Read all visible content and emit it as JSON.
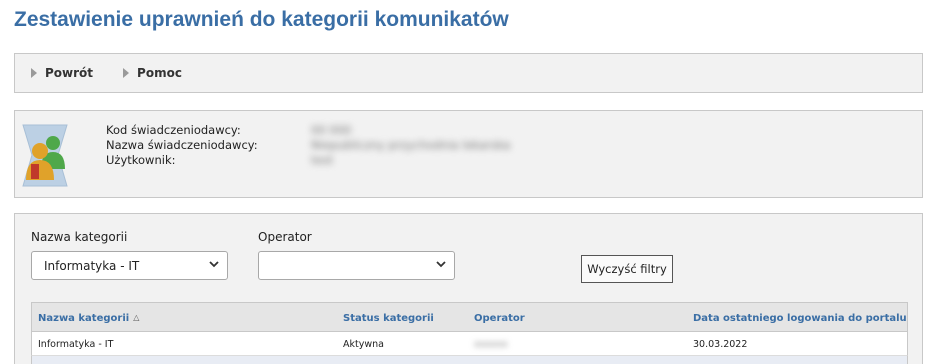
{
  "page": {
    "title": "Zestawienie uprawnień do kategorii komunikatów"
  },
  "toolbar": {
    "back_label": "Powrót",
    "help_label": "Pomoc"
  },
  "info": {
    "provider_code_label": "Kod świadczeniodawcy:",
    "provider_name_label": "Nazwa świadczeniodawcy:",
    "user_label": "Użytkownik:",
    "provider_code_value": "00 000",
    "provider_name_value": "Niepubliczny przychodnia lekarska",
    "user_value": "test"
  },
  "filters": {
    "category_label": "Nazwa kategorii",
    "category_selected": "Informatyka - IT",
    "operator_label": "Operator",
    "operator_selected": "",
    "clear_label": "Wyczyść filtry"
  },
  "table": {
    "columns": [
      "Nazwa kategorii",
      "Status kategorii",
      "Operator",
      "Data ostatniego logowania do portalu"
    ],
    "rows": [
      {
        "category": "Informatyka - IT",
        "status": "Aktywna",
        "operator": "xxxxxx",
        "last_login": "30.03.2022"
      }
    ]
  },
  "colors": {
    "accent": "#3a6ea5",
    "panel_bg": "#f2f2f2",
    "border": "#c8c8c8"
  },
  "icons": [
    "users-icon",
    "arrow-right-icon",
    "chevron-down-icon",
    "sort-asc-icon"
  ]
}
